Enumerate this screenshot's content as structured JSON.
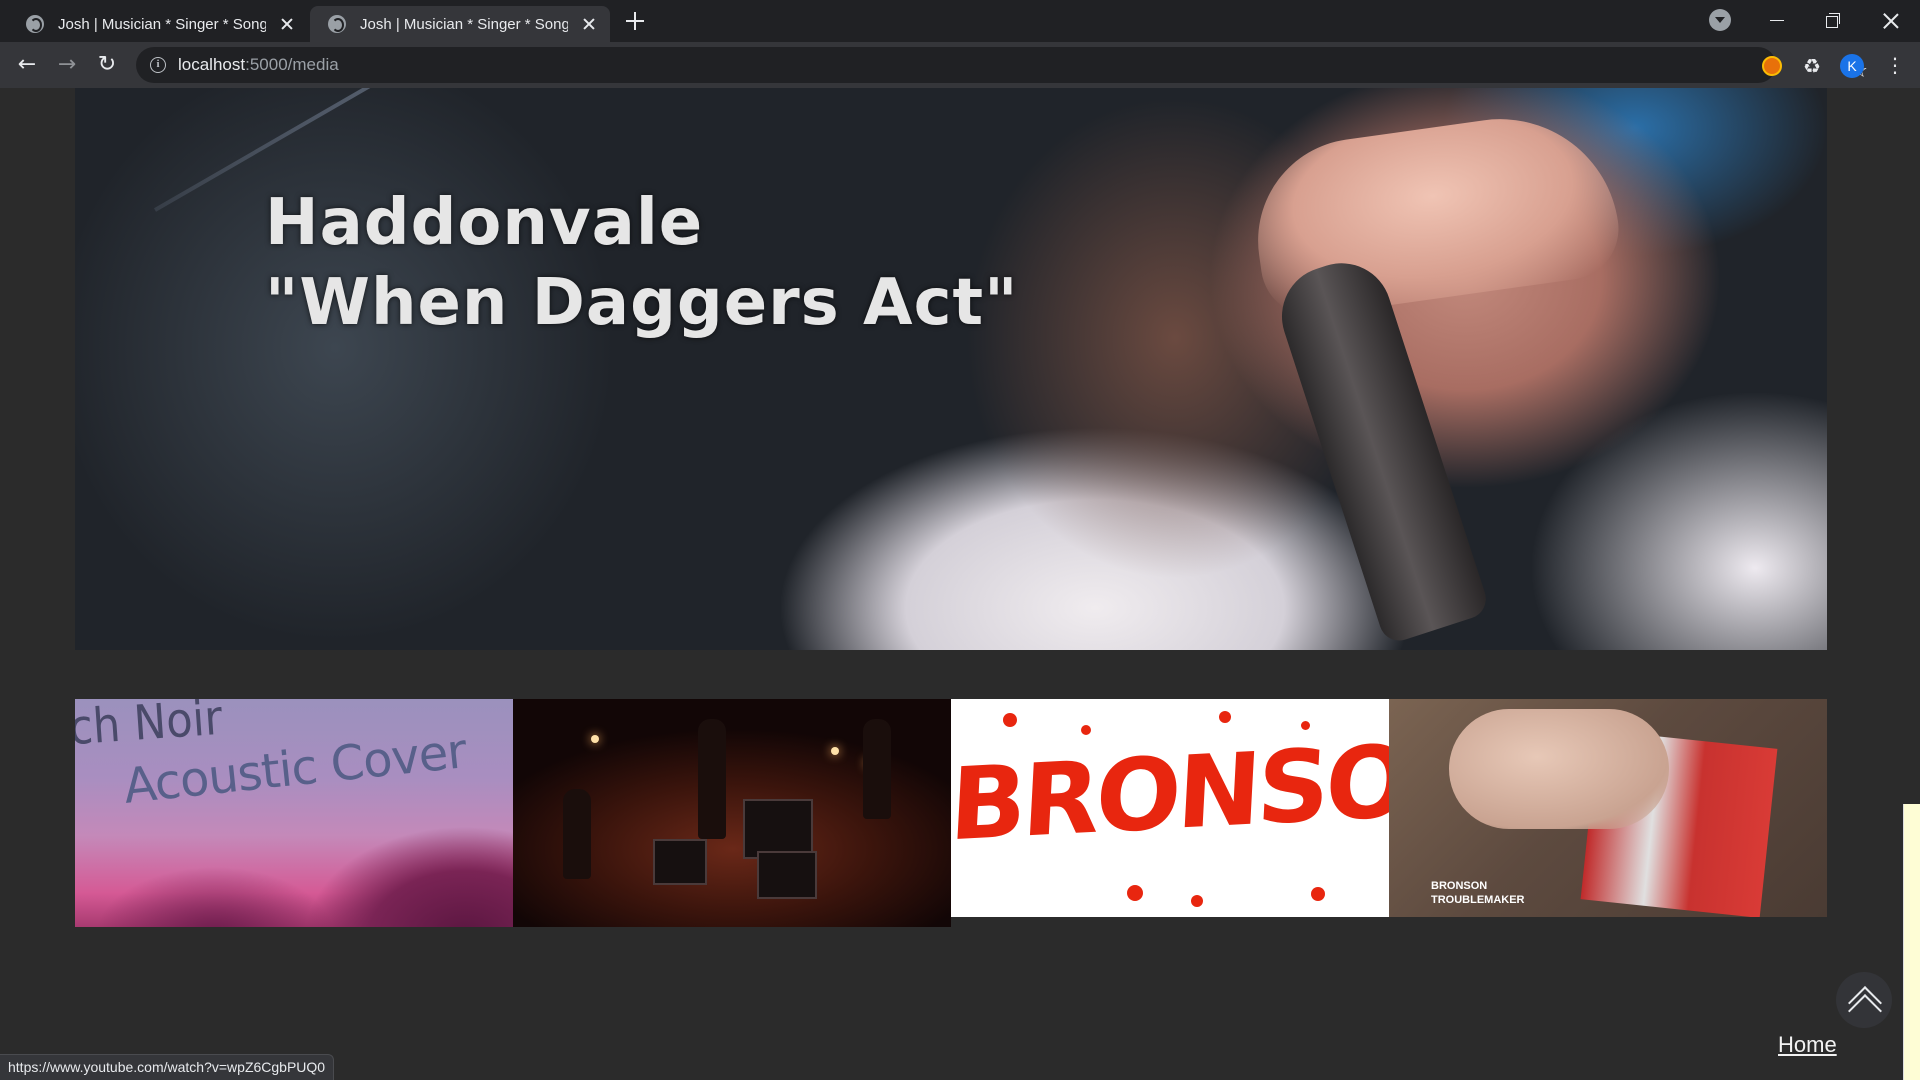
{
  "browser": {
    "tabs": [
      {
        "title": "Josh | Musician * Singer * Songwriter",
        "active": false
      },
      {
        "title": "Josh | Musician * Singer * Songwriter",
        "active": true
      }
    ],
    "address_host": "localhost",
    "address_path": ":5000/media",
    "profile_initial": "K",
    "status_url": "https://www.youtube.com/watch?v=wpZ6CgbPUQ0"
  },
  "hero_video": {
    "title": "Haddonvale\n\"When Daggers Act\""
  },
  "thumbnails": [
    {
      "text_top": "ch Noir",
      "text_main": "Acoustic Cover"
    },
    {
      "text": ""
    },
    {
      "text": "BRONSON"
    },
    {
      "caption_line1": "BRONSON",
      "caption_line2": "TROUBLEMAKER"
    }
  ],
  "footer": {
    "home_label": "Home"
  },
  "icons": {
    "back": "arrow-left-icon",
    "forward": "arrow-right-icon",
    "reload": "reload-icon",
    "info": "info-icon",
    "bookmark": "star-icon",
    "extensions": "puzzle-icon",
    "scroll_top": "double-chevron-up-icon"
  },
  "colors": {
    "page_bg": "#2b2b2b",
    "bronson_red": "#e8260f",
    "chrome_dark": "#202124"
  }
}
